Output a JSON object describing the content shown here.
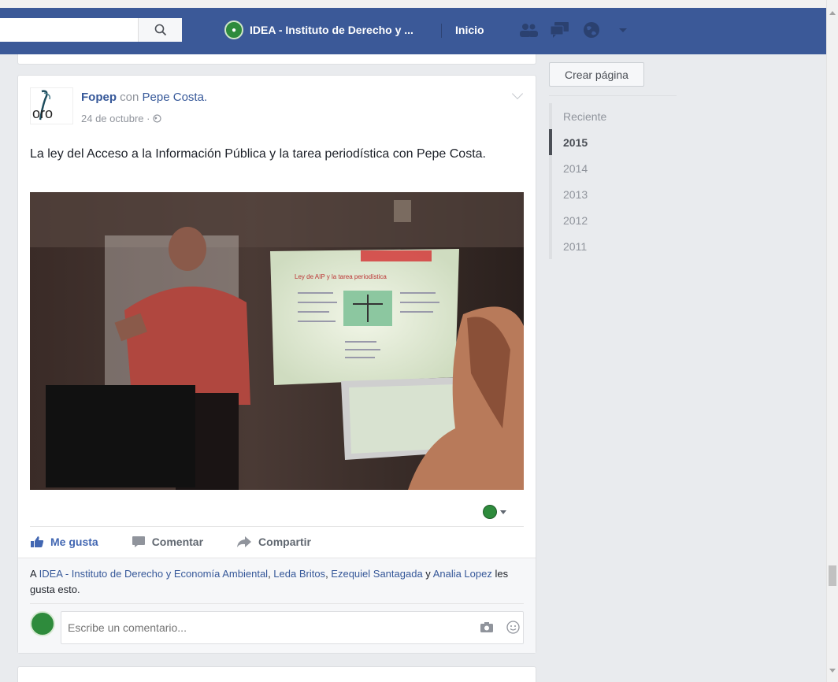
{
  "topbar": {
    "page_name": "IDEA - Instituto de Derecho y ...",
    "home": "Inicio"
  },
  "post": {
    "author": "Fopep",
    "connector": "con",
    "tagged": "Pepe Costa.",
    "avatar_text": "oro",
    "date": "24 de octubre · ",
    "text": "La ley del Acceso a la Información Pública y la tarea periodística con Pepe Costa.",
    "slide_title": "Ley de AIP y la tarea periodística",
    "actions": {
      "like": "Me gusta",
      "comment": "Comentar",
      "share": "Compartir"
    },
    "likes": {
      "prefix": "A ",
      "names": [
        "IDEA - Instituto de Derecho y Economía Ambiental",
        "Leda Britos",
        "Ezequiel Santagada"
      ],
      "and": " y ",
      "last": "Analia Lopez",
      "suffix": " les gusta esto."
    },
    "comment_placeholder": "Escribe un comentario..."
  },
  "sidebar": {
    "create_page": "Crear página",
    "timeline": [
      {
        "label": "Reciente",
        "active": false
      },
      {
        "label": "2015",
        "active": true
      },
      {
        "label": "2014",
        "active": false
      },
      {
        "label": "2013",
        "active": false
      },
      {
        "label": "2012",
        "active": false
      },
      {
        "label": "2011",
        "active": false
      }
    ]
  },
  "colors": {
    "brand": "#3b5998",
    "link": "#365899",
    "like": "#4267b2"
  }
}
